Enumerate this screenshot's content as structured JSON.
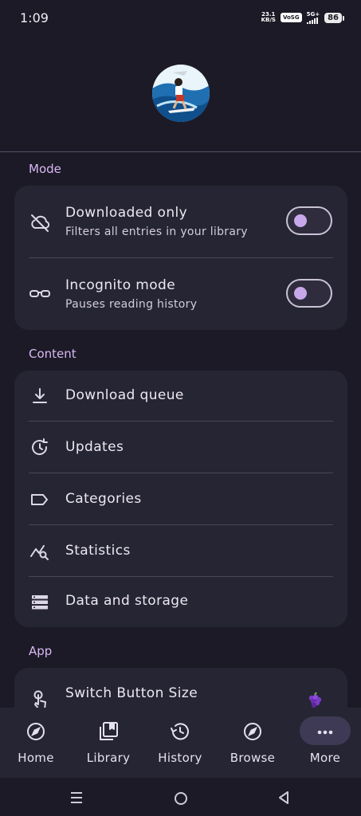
{
  "status_bar": {
    "time": "1:09",
    "net_speed_value": "23.1",
    "net_speed_unit": "KB/S",
    "volte": "VoSG",
    "signal_label": "5G+",
    "battery": "86"
  },
  "sections": {
    "mode": {
      "title": "Mode",
      "downloaded_only": {
        "title": "Downloaded only",
        "subtitle": "Filters all entries in your library",
        "enabled": false
      },
      "incognito": {
        "title": "Incognito mode",
        "subtitle": "Pauses reading history",
        "enabled": false
      }
    },
    "content": {
      "title": "Content",
      "items": [
        "Download queue",
        "Updates",
        "Categories",
        "Statistics",
        "Data and storage"
      ]
    },
    "app": {
      "title": "App",
      "items": [
        "Switch Button Size"
      ]
    }
  },
  "bottom_nav": {
    "items": [
      {
        "label": "Home",
        "icon": "compass-icon"
      },
      {
        "label": "Library",
        "icon": "library-icon"
      },
      {
        "label": "History",
        "icon": "history-icon"
      },
      {
        "label": "Browse",
        "icon": "compass-icon"
      },
      {
        "label": "More",
        "icon": "more-dots-icon",
        "selected": true
      }
    ]
  },
  "colors": {
    "background": "#1b1a26",
    "card": "#262533",
    "accent": "#d9b8f5",
    "selected_pill": "#3e3a55"
  }
}
